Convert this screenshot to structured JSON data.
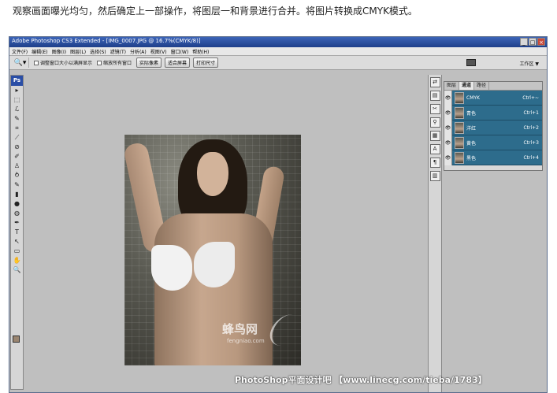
{
  "caption": "观察画面曝光均匀，然后确定上一部操作，将图层一和背景进行合并。将图片转换成CMYK模式。",
  "window": {
    "title": "Adobe Photoshop CS3 Extended - [IMG_0007.JPG @ 16.7%(CMYK/8)]",
    "buttons": [
      "_",
      "□",
      "×"
    ]
  },
  "menu": [
    "文件(F)",
    "编辑(E)",
    "图像(I)",
    "图层(L)",
    "选择(S)",
    "滤镜(T)",
    "分析(A)",
    "视图(V)",
    "窗口(W)",
    "帮助(H)"
  ],
  "options_bar": {
    "preset_icon": "zoom-icon",
    "checkbox_resize": "调整窗口大小以满屏显示",
    "checkbox_zoom_all": "缩放所有窗口",
    "btn_actual": "实际像素",
    "btn_fit": "适合屏幕",
    "btn_print": "打印尺寸",
    "workspace": "工作区 ▼"
  },
  "toolbox": {
    "logo": "Ps",
    "tools": [
      "▸",
      "⬚",
      "ℒ",
      "✎",
      "⌗",
      "⟋",
      "⊘",
      "✐",
      "♙",
      "⥁",
      "✎",
      "▮",
      "●",
      "◍",
      "✒",
      "T",
      "↖",
      "▭",
      "✋",
      "🔍"
    ]
  },
  "canvas": {
    "watermark_cn": "蜂鸟网",
    "watermark_en": "fengniao.com"
  },
  "dock_icons": [
    "⇄",
    "▤",
    "✂",
    "⚲",
    "▦",
    "A",
    "¶",
    "▥"
  ],
  "channels_panel": {
    "tabs": [
      "图层",
      "通道",
      "路径"
    ],
    "active_tab": "通道",
    "rows": [
      {
        "name": "CMYK",
        "shortcut": "Ctrl+~"
      },
      {
        "name": "青色",
        "shortcut": "Ctrl+1"
      },
      {
        "name": "洋红",
        "shortcut": "Ctrl+2"
      },
      {
        "name": "黄色",
        "shortcut": "Ctrl+3"
      },
      {
        "name": "黑色",
        "shortcut": "Ctrl+4"
      }
    ]
  },
  "footer_watermark": "PhotoShop平面设计吧 【www.linecg.com/tieba/1783】",
  "colors": {
    "title_bar": "#1e3f8a",
    "channel_row": "#2d6c8c",
    "foreground_swatch": "#9a8570"
  }
}
